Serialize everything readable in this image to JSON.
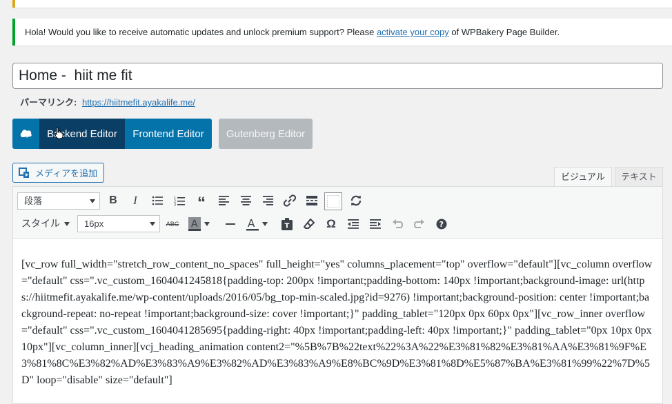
{
  "notice": {
    "text_before": "Hola! Would you like to receive automatic updates and unlock premium support? Please ",
    "link": "activate your copy",
    "text_after": " of WPBakery Page Builder."
  },
  "post": {
    "title": "Home -  hiit me fit",
    "permalink_label": "パーマリンク:",
    "permalink_url": "https://hiitmefit.ayakalife.me/"
  },
  "editor_switch": {
    "backend": "Backend Editor",
    "frontend": "Frontend Editor",
    "gutenberg": "Gutenberg Editor"
  },
  "media_button": "メディアを追加",
  "tabs": {
    "visual": "ビジュアル",
    "text": "テキスト"
  },
  "toolbar": {
    "format_select": "段落",
    "style_label": "スタイル",
    "font_size": "16px"
  },
  "content": "[vc_row full_width=\"stretch_row_content_no_spaces\" full_height=\"yes\" columns_placement=\"top\" overflow=\"default\"][vc_column overflow=\"default\" css=\".vc_custom_1604041245818{padding-top: 200px !important;padding-bottom: 140px !important;background-image: url(https://hiitmefit.ayakalife.me/wp-content/uploads/2016/05/bg_top-min-scaled.jpg?id=9276) !important;background-position: center !important;background-repeat: no-repeat !important;background-size: cover !important;}\" padding_tablet=\"120px 0px 60px 0px\"][vc_row_inner overflow=\"default\" css=\".vc_custom_1604041285695{padding-right: 40px !important;padding-left: 40px !important;}\" padding_tablet=\"0px 10px 0px 10px\"][vc_column_inner][vcj_heading_animation content2=\"%5B%7B%22text%22%3A%22%E3%81%82%E3%81%AA%E3%81%9F%E3%81%8C%E3%82%AD%E3%83%A9%E3%82%AD%E3%83%A9%E8%BC%9D%E3%81%8D%E5%87%BA%E3%81%99%22%7D%5D\" loop=\"disable\" size=\"default\"]",
  "colors": {
    "wp_blue": "#2271b1",
    "vc_blue": "#0473aa",
    "vc_dark": "#0b3e64",
    "gutenberg_gray": "#b4b9be",
    "notice_green": "#00a32a",
    "notice_yellow": "#dba617"
  }
}
